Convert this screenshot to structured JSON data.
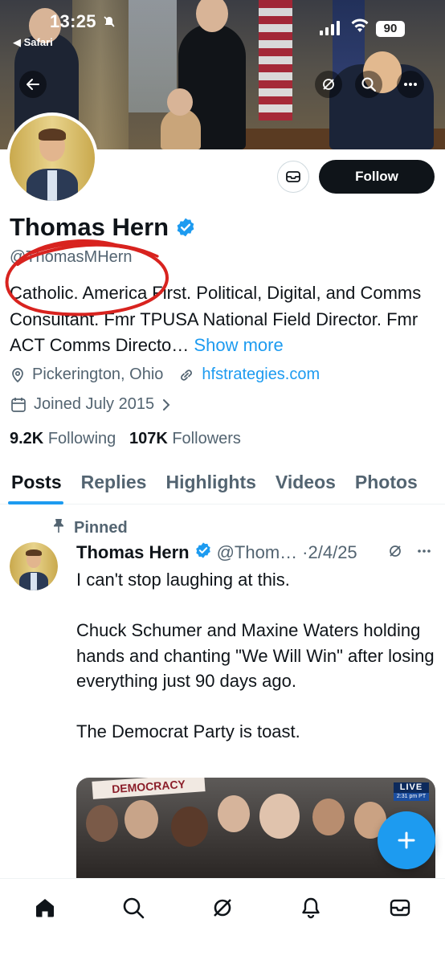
{
  "status_bar": {
    "time": "13:25",
    "back_app": "◀ Safari",
    "battery": "90"
  },
  "profile": {
    "name": "Thomas Hern",
    "handle": "@ThomasMHern",
    "bio": "Catholic. America First. Political, Digital, and Comms Consultant. Fmr TPUSA National Field Director. Fmr ACT Comms Directo…",
    "show_more": "Show more",
    "location": "Pickerington, Ohio",
    "website": "hfstrategies.com",
    "joined": "Joined July 2015",
    "following_count": "9.2K",
    "following_label": "Following",
    "followers_count": "107K",
    "followers_label": "Followers",
    "follow_button": "Follow"
  },
  "tabs": [
    {
      "label": "Posts",
      "active": true
    },
    {
      "label": "Replies",
      "active": false
    },
    {
      "label": "Highlights",
      "active": false
    },
    {
      "label": "Videos",
      "active": false
    },
    {
      "label": "Photos",
      "active": false
    }
  ],
  "post": {
    "pinned_label": "Pinned",
    "author": "Thomas Hern",
    "handle": "@Thom…",
    "date": "·2/4/25",
    "text": "I can't stop laughing at this.\n\nChuck Schumer and Maxine Waters holding hands and chanting \"We Will Win\" after losing everything just 90 days ago.\n\nThe Democrat Party is toast.",
    "media": {
      "sign_text": "DEMOCRACY",
      "live_label": "LIVE",
      "live_time": "2:31 pm PT"
    }
  },
  "icons": {
    "back": "arrow-left-icon",
    "grok": "grok-icon",
    "search": "search-icon",
    "more": "more-icon",
    "message": "mail-icon",
    "verified": "verified-badge-icon",
    "location": "location-pin-icon",
    "link": "link-icon",
    "calendar": "calendar-icon",
    "pin": "pin-icon",
    "compose": "plus-icon",
    "nav": [
      "home-icon",
      "search-icon",
      "grok-icon",
      "bell-icon",
      "mail-icon"
    ]
  },
  "colors": {
    "accent": "#1d9bf0",
    "text_primary": "#0f1419",
    "text_secondary": "#536471",
    "annotation": "#d8231f"
  }
}
